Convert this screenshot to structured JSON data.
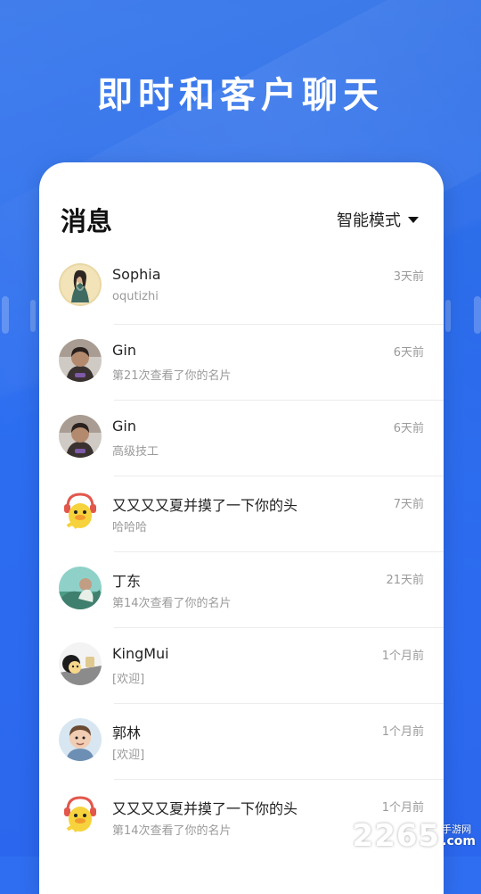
{
  "headline": "即时和客户聊天",
  "card": {
    "title": "消息",
    "mode_select": "智能模式"
  },
  "messages": [
    {
      "name": "Sophia",
      "preview": "oqutizhi",
      "time": "3天前",
      "avatar": "woman-painting-avatar"
    },
    {
      "name": "Gin",
      "preview": "第21次查看了你的名片",
      "time": "6天前",
      "avatar": "child-photo-avatar"
    },
    {
      "name": "Gin",
      "preview": "高级技工",
      "time": "6天前",
      "avatar": "child-photo-avatar"
    },
    {
      "name": "又又又又夏并摸了一下你的头",
      "preview": "哈哈哈",
      "time": "7天前",
      "avatar": "cartoon-duck-avatar"
    },
    {
      "name": "丁东",
      "preview": "第14次查看了你的名片",
      "time": "21天前",
      "avatar": "outdoor-photo-avatar"
    },
    {
      "name": "KingMui",
      "preview": "[欢迎]",
      "time": "1个月前",
      "avatar": "cartoon-character-avatar"
    },
    {
      "name": "郭林",
      "preview": "[欢迎]",
      "time": "1个月前",
      "avatar": "boy-photo-avatar"
    },
    {
      "name": "又又又又夏并摸了一下你的头",
      "preview": "第14次查看了你的名片",
      "time": "1个月前",
      "avatar": "cartoon-duck-avatar"
    }
  ],
  "watermark": {
    "number": "2265",
    "cn": "手游网",
    "com": ".com"
  }
}
